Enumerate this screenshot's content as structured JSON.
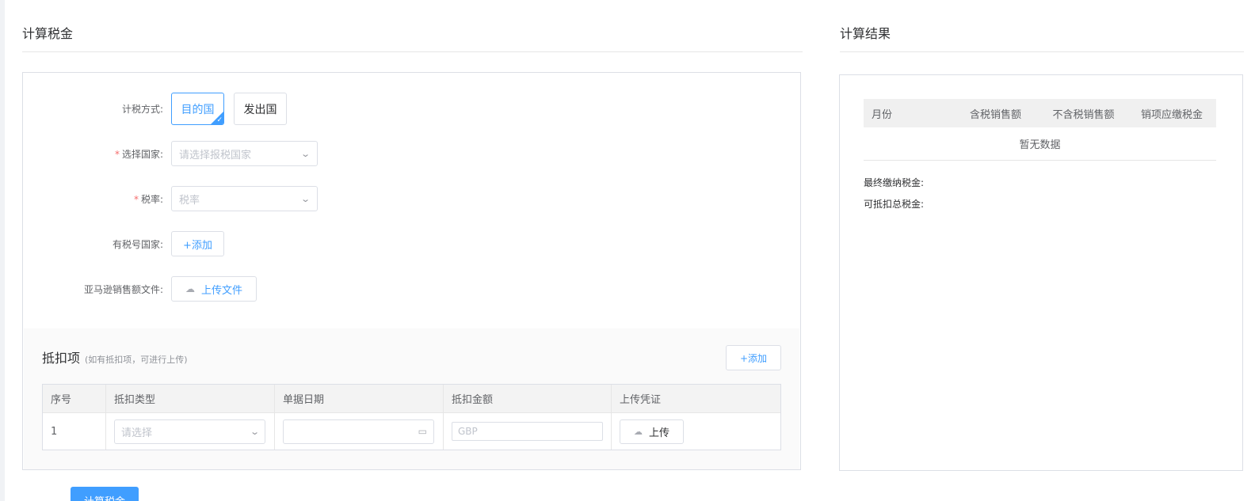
{
  "calc": {
    "title": "计算税金",
    "method_label": "计税方式:",
    "method_options": [
      "目的国",
      "发出国"
    ],
    "method_selected": "目的国",
    "country_label": "选择国家:",
    "country_placeholder": "请选择报税国家",
    "rate_label": "税率:",
    "rate_placeholder": "税率",
    "tax_country_label": "有税号国家:",
    "tax_country_add": "+添加",
    "file_label": "亚马逊销售额文件:",
    "file_upload": "上传文件",
    "required_mark": "*"
  },
  "deductions": {
    "title": "抵扣项",
    "hint": "(如有抵扣项，可进行上传)",
    "add": "+添加",
    "columns": [
      "序号",
      "抵扣类型",
      "单据日期",
      "抵扣金额",
      "上传凭证"
    ],
    "rows": [
      {
        "index": "1",
        "type_placeholder": "请选择",
        "amount_placeholder": "GBP",
        "upload": "上传"
      }
    ]
  },
  "result": {
    "title": "计算结果",
    "columns": [
      "月份",
      "含税销售额",
      "不含税销售额",
      "销项应缴税金"
    ],
    "empty": "暂无数据",
    "final_tax_label": "最终缴纳税金:",
    "deductible_label": "可抵扣总税金:"
  },
  "actions": {
    "calculate": "计算税金"
  },
  "icons": {
    "select_arrow": "chevron-down-icon",
    "upload": "cloud-upload-icon",
    "date": "calendar-icon",
    "selected": "check-corner-icon"
  },
  "colors": {
    "accent": "#409eff",
    "required": "#f56c6c"
  }
}
